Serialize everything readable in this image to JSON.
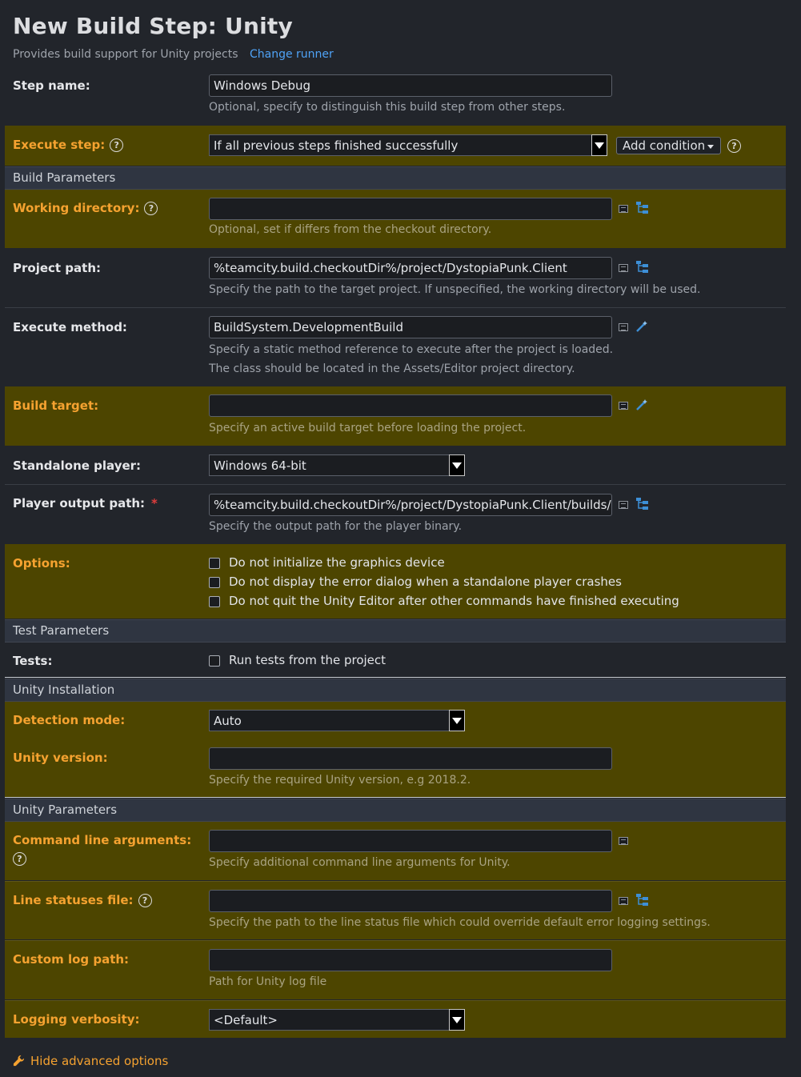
{
  "header": {
    "title": "New Build Step: Unity",
    "subtitle": "Provides build support for Unity projects",
    "change_runner": "Change runner"
  },
  "step_name": {
    "label": "Step name:",
    "value": "Windows Debug",
    "note": "Optional, specify to distinguish this build step from other steps."
  },
  "execute_step": {
    "label": "Execute step:",
    "value": "If all previous steps finished successfully",
    "add_condition": "Add condition"
  },
  "sections": {
    "build_parameters": "Build Parameters",
    "test_parameters": "Test Parameters",
    "unity_installation": "Unity Installation",
    "unity_parameters": "Unity Parameters"
  },
  "working_directory": {
    "label": "Working directory:",
    "value": "",
    "note": "Optional, set if differs from the checkout directory."
  },
  "project_path": {
    "label": "Project path:",
    "value": "%teamcity.build.checkoutDir%/project/DystopiaPunk.Client",
    "note": "Specify the path to the target project. If unspecified, the working directory will be used."
  },
  "execute_method": {
    "label": "Execute method:",
    "value": "BuildSystem.DevelopmentBuild",
    "note1": "Specify a static method reference to execute after the project is loaded.",
    "note2": "The class should be located in the Assets/Editor project directory."
  },
  "build_target": {
    "label": "Build target:",
    "value": "",
    "note": "Specify an active build target before loading the project."
  },
  "standalone_player": {
    "label": "Standalone player:",
    "value": "Windows 64-bit"
  },
  "player_output_path": {
    "label": "Player output path:",
    "required_mark": "*",
    "value": "%teamcity.build.checkoutDir%/project/DystopiaPunk.Client/builds/De",
    "note": "Specify the output path for the player binary."
  },
  "options": {
    "label": "Options:",
    "items": [
      {
        "label": "Do not initialize the graphics device",
        "checked": false
      },
      {
        "label": "Do not display the error dialog when a standalone player crashes",
        "checked": false
      },
      {
        "label": "Do not quit the Unity Editor after other commands have finished executing",
        "checked": false
      }
    ]
  },
  "tests": {
    "label": "Tests:",
    "checkbox_label": "Run tests from the project",
    "checked": false
  },
  "detection_mode": {
    "label": "Detection mode:",
    "value": "Auto"
  },
  "unity_version": {
    "label": "Unity version:",
    "value": "",
    "note": "Specify the required Unity version, e.g 2018.2."
  },
  "command_line_arguments": {
    "label": "Command line arguments:",
    "value": "",
    "note": "Specify additional command line arguments for Unity."
  },
  "line_statuses_file": {
    "label": "Line statuses file:",
    "value": "",
    "note": "Specify the path to the line status file which could override default error logging settings."
  },
  "custom_log_path": {
    "label": "Custom log path:",
    "value": "",
    "note": "Path for Unity log file"
  },
  "logging_verbosity": {
    "label": "Logging verbosity:",
    "value": "<Default>"
  },
  "footer": {
    "hide_advanced": "Hide advanced options"
  },
  "colors": {
    "advanced_bg": "#4d4500",
    "advanced_label": "#f5a230",
    "page_bg": "#22252b",
    "link": "#4fa3f7"
  }
}
